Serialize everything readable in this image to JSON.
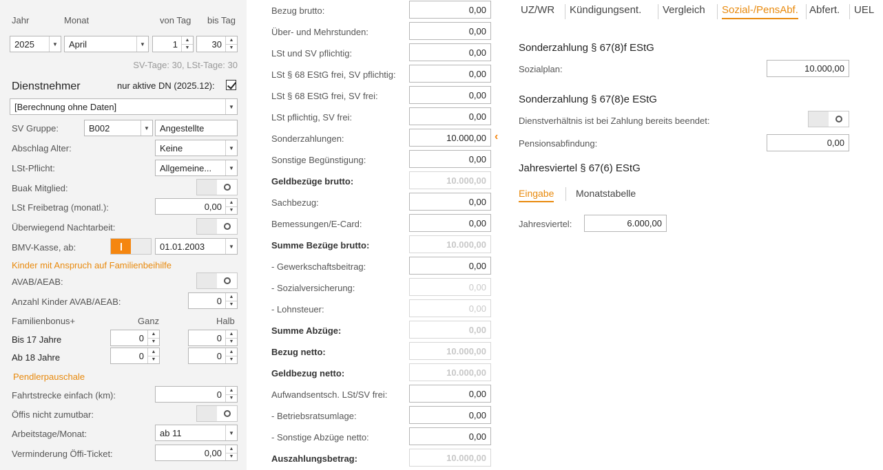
{
  "period": {
    "jahr_label": "Jahr",
    "monat_label": "Monat",
    "von_label": "von Tag",
    "bis_label": "bis Tag",
    "jahr": "2025",
    "monat": "April",
    "von": "1",
    "bis": "30",
    "info": "SV-Tage: 30,  LSt-Tage: 30"
  },
  "dn": {
    "title": "Dienstnehmer",
    "aktive_label": "nur aktive DN (2025.12):",
    "selected": "[Berechnung ohne Daten]",
    "sv_gruppe_label": "SV Gruppe:",
    "sv_gruppe": "B002",
    "sv_gruppe_name": "Angestellte",
    "abschlag_label": "Abschlag Alter:",
    "abschlag": "Keine",
    "lst_pflicht_label": "LSt-Pflicht:",
    "lst_pflicht": "Allgemeine...",
    "buak_label": "Buak Mitglied:",
    "freibetrag_label": "LSt Freibetrag (monatl.):",
    "freibetrag": "0,00",
    "nacht_label": "Überwiegend Nachtarbeit:",
    "bmv_label": "BMV-Kasse, ab:",
    "bmv_date": "01.01.2003",
    "kinder_title": "Kinder mit Anspruch auf Familienbeihilfe",
    "avab_label": "AVAB/AEAB:",
    "anzahl_label": "Anzahl Kinder AVAB/AEAB:",
    "anzahl": "0",
    "fb_label": "Familienbonus+",
    "ganz_label": "Ganz",
    "halb_label": "Halb",
    "bis17_label": "Bis 17 Jahre",
    "bis17_ganz": "0",
    "bis17_halb": "0",
    "ab18_label": "Ab 18 Jahre",
    "ab18_ganz": "0",
    "ab18_halb": "0",
    "pendler_title": "Pendlerpauschale",
    "fahrt_label": "Fahrtstrecke einfach (km):",
    "fahrt": "0",
    "oeffi_label": "Öffis nicht zumutbar:",
    "arbeitstage_label": "Arbeitstage/Monat:",
    "arbeitstage": "ab 11",
    "verminderung_label": "Verminderung Öffi-Ticket:",
    "verminderung": "0,00"
  },
  "bezug": [
    {
      "label": "Bezug brutto:",
      "value": "0,00",
      "bold": false,
      "disabled": false
    },
    {
      "label": "Über- und Mehrstunden:",
      "value": "0,00",
      "bold": false,
      "disabled": false
    },
    {
      "label": "LSt und SV pflichtig:",
      "value": "0,00",
      "bold": false,
      "disabled": false
    },
    {
      "label": "LSt § 68 EStG frei, SV pflichtig:",
      "value": "0,00",
      "bold": false,
      "disabled": false
    },
    {
      "label": "LSt § 68 EStG frei, SV frei:",
      "value": "0,00",
      "bold": false,
      "disabled": false
    },
    {
      "label": "LSt pflichtig, SV frei:",
      "value": "0,00",
      "bold": false,
      "disabled": false
    },
    {
      "label": "Sonderzahlungen:",
      "value": "10.000,00",
      "bold": false,
      "disabled": false
    },
    {
      "label": "Sonstige Begünstigung:",
      "value": "0,00",
      "bold": false,
      "disabled": false
    },
    {
      "label": "Geldbezüge brutto:",
      "value": "10.000,00",
      "bold": true,
      "disabled": true
    },
    {
      "label": "Sachbezug:",
      "value": "0,00",
      "bold": false,
      "disabled": false
    },
    {
      "label": "Bemessungen/E-Card:",
      "value": "0,00",
      "bold": false,
      "disabled": false
    },
    {
      "label": "Summe Bezüge brutto:",
      "value": "10.000,00",
      "bold": true,
      "disabled": true
    },
    {
      "label": "- Gewerkschaftsbeitrag:",
      "value": "0,00",
      "bold": false,
      "disabled": false
    },
    {
      "label": "- Sozialversicherung:",
      "value": "0,00",
      "bold": false,
      "disabled": true
    },
    {
      "label": "- Lohnsteuer:",
      "value": "0,00",
      "bold": false,
      "disabled": true
    },
    {
      "label": "Summe Abzüge:",
      "value": "0,00",
      "bold": true,
      "disabled": true
    },
    {
      "label": "Bezug netto:",
      "value": "10.000,00",
      "bold": true,
      "disabled": true
    },
    {
      "label": "Geldbezug netto:",
      "value": "10.000,00",
      "bold": true,
      "disabled": true
    },
    {
      "label": "Aufwandsentsch. LSt/SV frei:",
      "value": "0,00",
      "bold": false,
      "disabled": false
    },
    {
      "label": "- Betriebsratsumlage:",
      "value": "0,00",
      "bold": false,
      "disabled": false
    },
    {
      "label": "- Sonstige Abzüge netto:",
      "value": "0,00",
      "bold": false,
      "disabled": false
    },
    {
      "label": "Auszahlungsbetrag:",
      "value": "10.000,00",
      "bold": true,
      "disabled": true
    }
  ],
  "tabs": [
    "UZ/WR",
    "Kündigungsent.",
    "Vergleich",
    "Sozial-/PensAbf.",
    "Abfert.",
    "UEL"
  ],
  "right": {
    "s1_title": "Sonderzahlung § 67(8)f EStG",
    "sozialplan_label": "Sozialplan:",
    "sozialplan": "10.000,00",
    "s2_title": "Sonderzahlung § 67(8)e EStG",
    "beendet_label": "Dienstverhältnis ist bei Zahlung bereits beendet:",
    "pension_label": "Pensionsabfindung:",
    "pension": "0,00",
    "s3_title": "Jahresviertel § 67(6) EStG",
    "subtab_eingabe": "Eingabe",
    "subtab_monat": "Monatstabelle",
    "jv_label": "Jahresviertel:",
    "jv": "6.000,00"
  },
  "colors": {
    "accent": "#f5860f"
  }
}
